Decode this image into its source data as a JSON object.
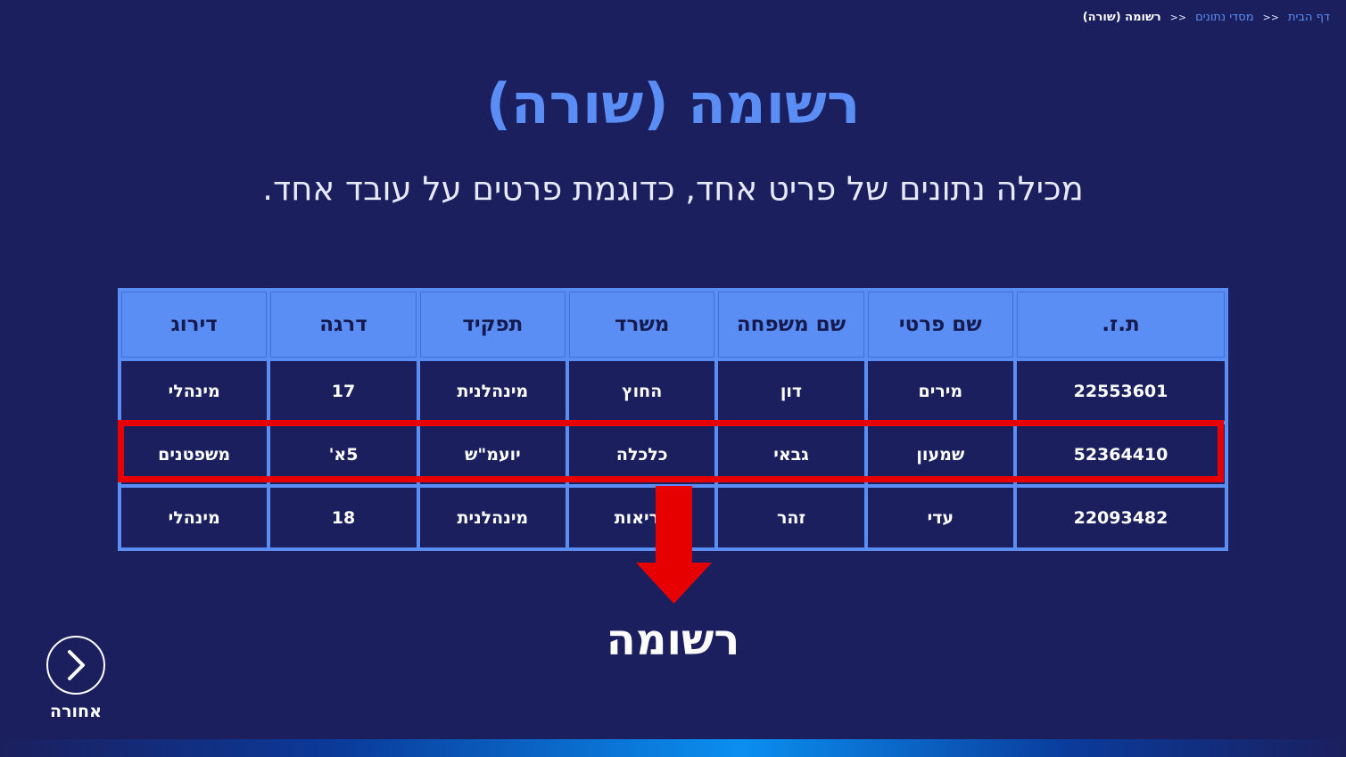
{
  "breadcrumb": {
    "home": "דף הבית",
    "databases": "מסדי נתונים",
    "current": "רשומה (שורה)",
    "separator": "<<"
  },
  "title": "רשומה (שורה)",
  "subtitle": "מכילה נתונים של פריט אחד, כדוגמת פרטים על עובד אחד.",
  "table": {
    "headers": [
      "ת.ז.",
      "שם פרטי",
      "שם משפחה",
      "משרד",
      "תפקיד",
      "דרגה",
      "דירוג"
    ],
    "rows": [
      [
        "22553601",
        "מירים",
        "דון",
        "החוץ",
        "מינהלנית",
        "17",
        "מינהלי"
      ],
      [
        "52364410",
        "שמעון",
        "גבאי",
        "כלכלה",
        "יועמ\"ש",
        "5א'",
        "משפטנים"
      ],
      [
        "22093482",
        "עדי",
        "זהר",
        "בריאות",
        "מינהלנית",
        "18",
        "מינהלי"
      ]
    ]
  },
  "record_label": "רשומה",
  "back_button": {
    "label": "אחורה",
    "icon": "chevron-right-icon"
  },
  "colors": {
    "background": "#1b1f5e",
    "accent": "#5b8ef5",
    "highlight": "#e60000"
  }
}
